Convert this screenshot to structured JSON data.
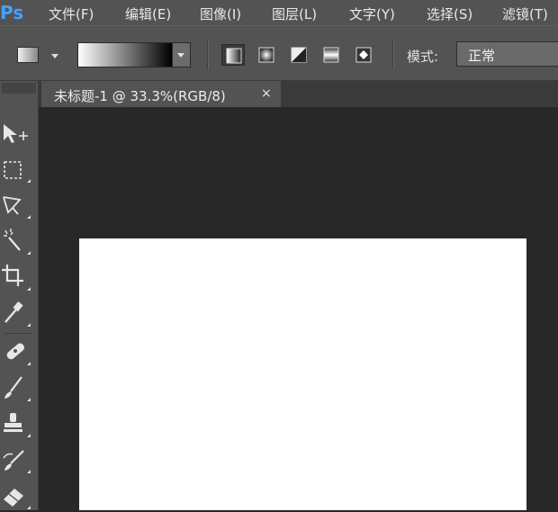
{
  "app": {
    "logo": "Ps"
  },
  "menu": {
    "items": [
      {
        "label": "文件(F)"
      },
      {
        "label": "编辑(E)"
      },
      {
        "label": "图像(I)"
      },
      {
        "label": "图层(L)"
      },
      {
        "label": "文字(Y)"
      },
      {
        "label": "选择(S)"
      },
      {
        "label": "滤镜(T)"
      }
    ]
  },
  "options_bar": {
    "tool_preset_icon": "gradient-preset-icon",
    "gradient_icon": "gradient-white-to-black",
    "gradient_types": [
      {
        "name": "linear-gradient-icon",
        "active": true
      },
      {
        "name": "radial-gradient-icon",
        "active": false
      },
      {
        "name": "angle-gradient-icon",
        "active": false
      },
      {
        "name": "reflected-gradient-icon",
        "active": false
      },
      {
        "name": "diamond-gradient-icon",
        "active": false
      }
    ],
    "mode_label": "模式:",
    "mode_value": "正常"
  },
  "document": {
    "tab_title": "未标题-1 @ 33.3%(RGB/8)",
    "close_glyph": "×",
    "canvas_color": "#ffffff"
  },
  "toolbox": {
    "tools": [
      "move-tool-icon",
      "rectangular-marquee-icon",
      "lasso-tool-icon",
      "magic-wand-icon",
      "crop-tool-icon",
      "eyedropper-icon",
      "healing-brush-icon",
      "brush-tool-icon",
      "clone-stamp-icon",
      "history-brush-icon",
      "eraser-tool-icon"
    ]
  },
  "colors": {
    "panel": "#535353",
    "workspace": "#282828",
    "accent": "#46a0ff"
  }
}
